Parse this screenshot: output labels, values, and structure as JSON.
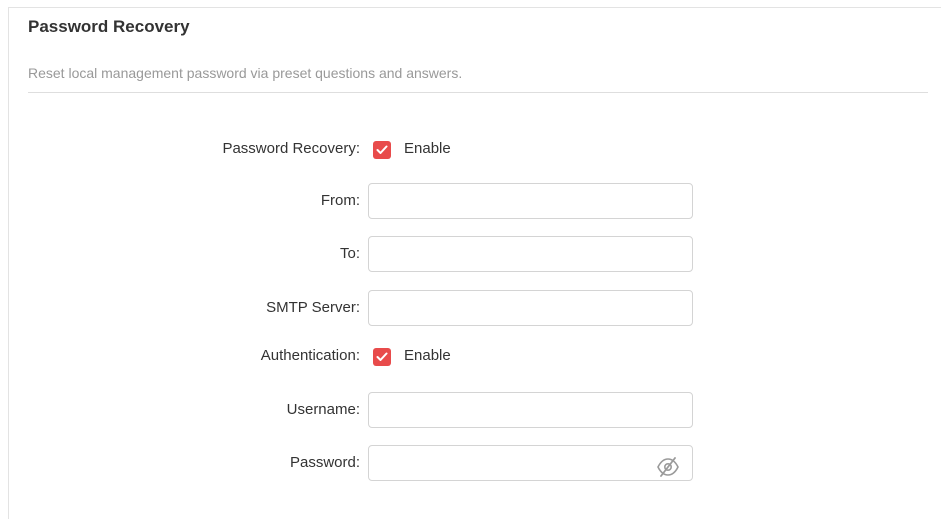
{
  "section": {
    "title": "Password Recovery",
    "description": "Reset local management password via preset questions and answers."
  },
  "form": {
    "password_recovery": {
      "label": "Password Recovery:",
      "checked": true,
      "option_label": "Enable"
    },
    "from": {
      "label": "From:",
      "value": ""
    },
    "to": {
      "label": "To:",
      "value": ""
    },
    "smtp_server": {
      "label": "SMTP Server:",
      "value": ""
    },
    "authentication": {
      "label": "Authentication:",
      "checked": true,
      "option_label": "Enable"
    },
    "username": {
      "label": "Username:",
      "value": ""
    },
    "password": {
      "label": "Password:",
      "value": "",
      "visibility_icon": "eye-slash-icon"
    }
  },
  "colors": {
    "checkbox_accent": "#e84b4b",
    "title_text": "#333333",
    "description_text": "#999999"
  }
}
